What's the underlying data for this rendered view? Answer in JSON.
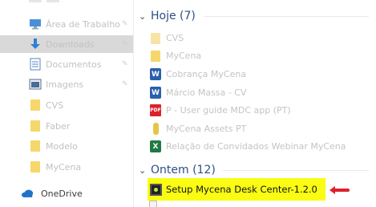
{
  "sidebar": {
    "items": [
      {
        "label": "Área de Trabalho",
        "icon": "desktop-icon",
        "pinned": true
      },
      {
        "label": "Downloads",
        "icon": "download-arrow-icon",
        "pinned": true,
        "selected": true
      },
      {
        "label": "Documentos",
        "icon": "documents-icon",
        "pinned": true
      },
      {
        "label": "Imagens",
        "icon": "pictures-icon",
        "pinned": true
      },
      {
        "label": "CVS",
        "icon": "folder-icon"
      },
      {
        "label": "Faber",
        "icon": "folder-icon"
      },
      {
        "label": "Modelo",
        "icon": "folder-icon"
      },
      {
        "label": "MyCena",
        "icon": "folder-icon"
      },
      {
        "label": "OneDrive",
        "icon": "cloud-icon"
      }
    ]
  },
  "groups": [
    {
      "label": "Hoje (7)",
      "files": [
        {
          "name": "CVS",
          "icon": "folder-icon"
        },
        {
          "name": "MyCena",
          "icon": "folder-icon"
        },
        {
          "name": "Cobrança MyCena",
          "icon": "word-document-icon"
        },
        {
          "name": "Márcio Massa - CV",
          "icon": "word-document-icon"
        },
        {
          "name": "P - User guide MDC app (PT)",
          "icon": "pdf-icon"
        },
        {
          "name": "MyCena Assets PT",
          "icon": "archive-icon"
        },
        {
          "name": "Relação de Convidados Webinar MyCena",
          "icon": "excel-icon"
        }
      ]
    },
    {
      "label": "Ontem (12)",
      "files": [
        {
          "name": "Setup Mycena Desk Center-1.2.0",
          "icon": "installer-icon",
          "highlighted": true,
          "highlight_color": "#fbfc14"
        }
      ]
    }
  ],
  "colors": {
    "accent_header": "#2d4f86",
    "highlight": "#fbfc14",
    "arrow": "#e0202a"
  }
}
